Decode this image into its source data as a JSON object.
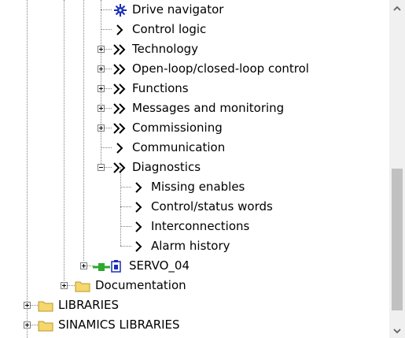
{
  "tree": {
    "items": [
      {
        "label": "Drive navigator",
        "icon": "drive-navigator-icon"
      },
      {
        "label": "Control logic",
        "icon": "chevron-right-icon"
      },
      {
        "label": "Technology",
        "icon": "double-chevron-icon",
        "expander": "plus"
      },
      {
        "label": "Open-loop/closed-loop control",
        "icon": "double-chevron-icon",
        "expander": "plus"
      },
      {
        "label": "Functions",
        "icon": "double-chevron-icon",
        "expander": "plus"
      },
      {
        "label": "Messages and monitoring",
        "icon": "double-chevron-icon",
        "expander": "plus"
      },
      {
        "label": "Commissioning",
        "icon": "double-chevron-icon",
        "expander": "plus"
      },
      {
        "label": "Communication",
        "icon": "chevron-right-icon"
      },
      {
        "label": "Diagnostics",
        "icon": "double-chevron-icon",
        "expander": "minus"
      },
      {
        "label": "Missing enables",
        "icon": "chevron-right-icon"
      },
      {
        "label": "Control/status words",
        "icon": "chevron-right-icon"
      },
      {
        "label": "Interconnections",
        "icon": "chevron-right-icon"
      },
      {
        "label": "Alarm history",
        "icon": "chevron-right-icon"
      },
      {
        "label": "SERVO_04",
        "icon": "servo-drive-icon",
        "expander": "plus"
      },
      {
        "label": "Documentation",
        "icon": "folder-icon",
        "expander": "plus"
      },
      {
        "label": "LIBRARIES",
        "icon": "folder-icon",
        "expander": "plus"
      },
      {
        "label": "SINAMICS LIBRARIES",
        "icon": "folder-icon",
        "expander": "plus"
      }
    ]
  },
  "scrollbar": {
    "up_icon": "scroll-up-arrow-icon",
    "down_icon": "scroll-down-arrow-icon"
  },
  "colors": {
    "navigator_blue": "#1a2fb8",
    "folder_yellow": "#f5d76e",
    "servo_green": "#2eaa2e",
    "scroll_thumb": "#c1c1c1"
  }
}
